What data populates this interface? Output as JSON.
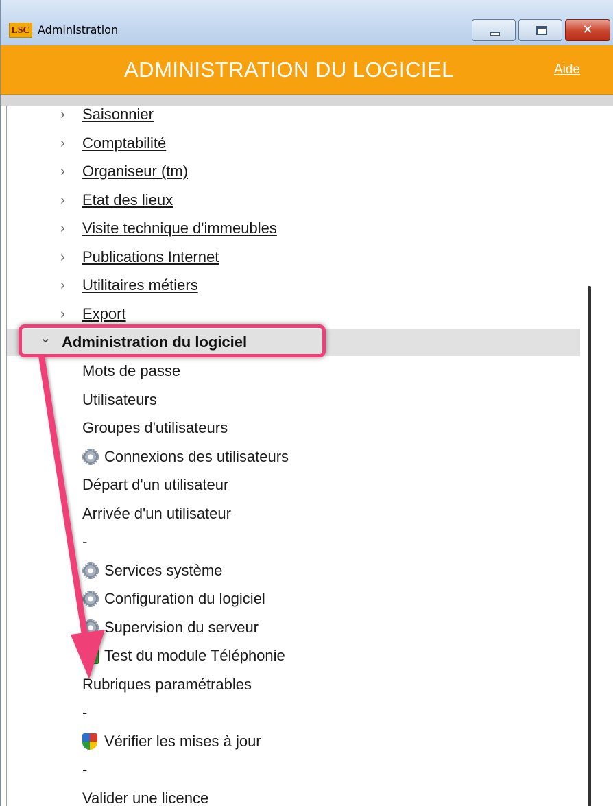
{
  "window": {
    "logo_text": "LSC",
    "title": "Administration",
    "close_glyph": "✕"
  },
  "header": {
    "title": "ADMINISTRATION DU LOGICIEL",
    "help_link": "Aide",
    "background_color": "#f7a10f"
  },
  "tree": {
    "collapsed_sections": [
      "Saisonnier",
      "Comptabilité",
      "Organiseur (tm)",
      "Etat des lieux",
      "Visite technique d'immeubles",
      "Publications Internet",
      "Utilitaires métiers",
      "Export"
    ],
    "expanded_section": "Administration du logiciel",
    "items": [
      {
        "label": "Mots de passe",
        "icon": ""
      },
      {
        "label": "Utilisateurs",
        "icon": ""
      },
      {
        "label": "Groupes d'utilisateurs",
        "icon": ""
      },
      {
        "label": "Connexions des utilisateurs",
        "icon": "gear-icon"
      },
      {
        "label": "Départ d'un utilisateur",
        "icon": ""
      },
      {
        "label": "Arrivée d'un utilisateur",
        "icon": ""
      },
      {
        "label": "-",
        "icon": ""
      },
      {
        "label": "Services système",
        "icon": "gear-icon"
      },
      {
        "label": "Configuration du logiciel",
        "icon": "gear-icon"
      },
      {
        "label": "Supervision du serveur",
        "icon": "gear-icon"
      },
      {
        "label": "Test du module Téléphonie",
        "icon": "phone-icon"
      },
      {
        "label": "Rubriques paramétrables",
        "icon": ""
      },
      {
        "label": "-",
        "icon": ""
      },
      {
        "label": "Vérifier les mises à jour",
        "icon": "shield-icon"
      },
      {
        "label": "-",
        "icon": ""
      },
      {
        "label": "Valider une licence",
        "icon": ""
      }
    ]
  },
  "annotation": {
    "color": "#ef3f78"
  }
}
